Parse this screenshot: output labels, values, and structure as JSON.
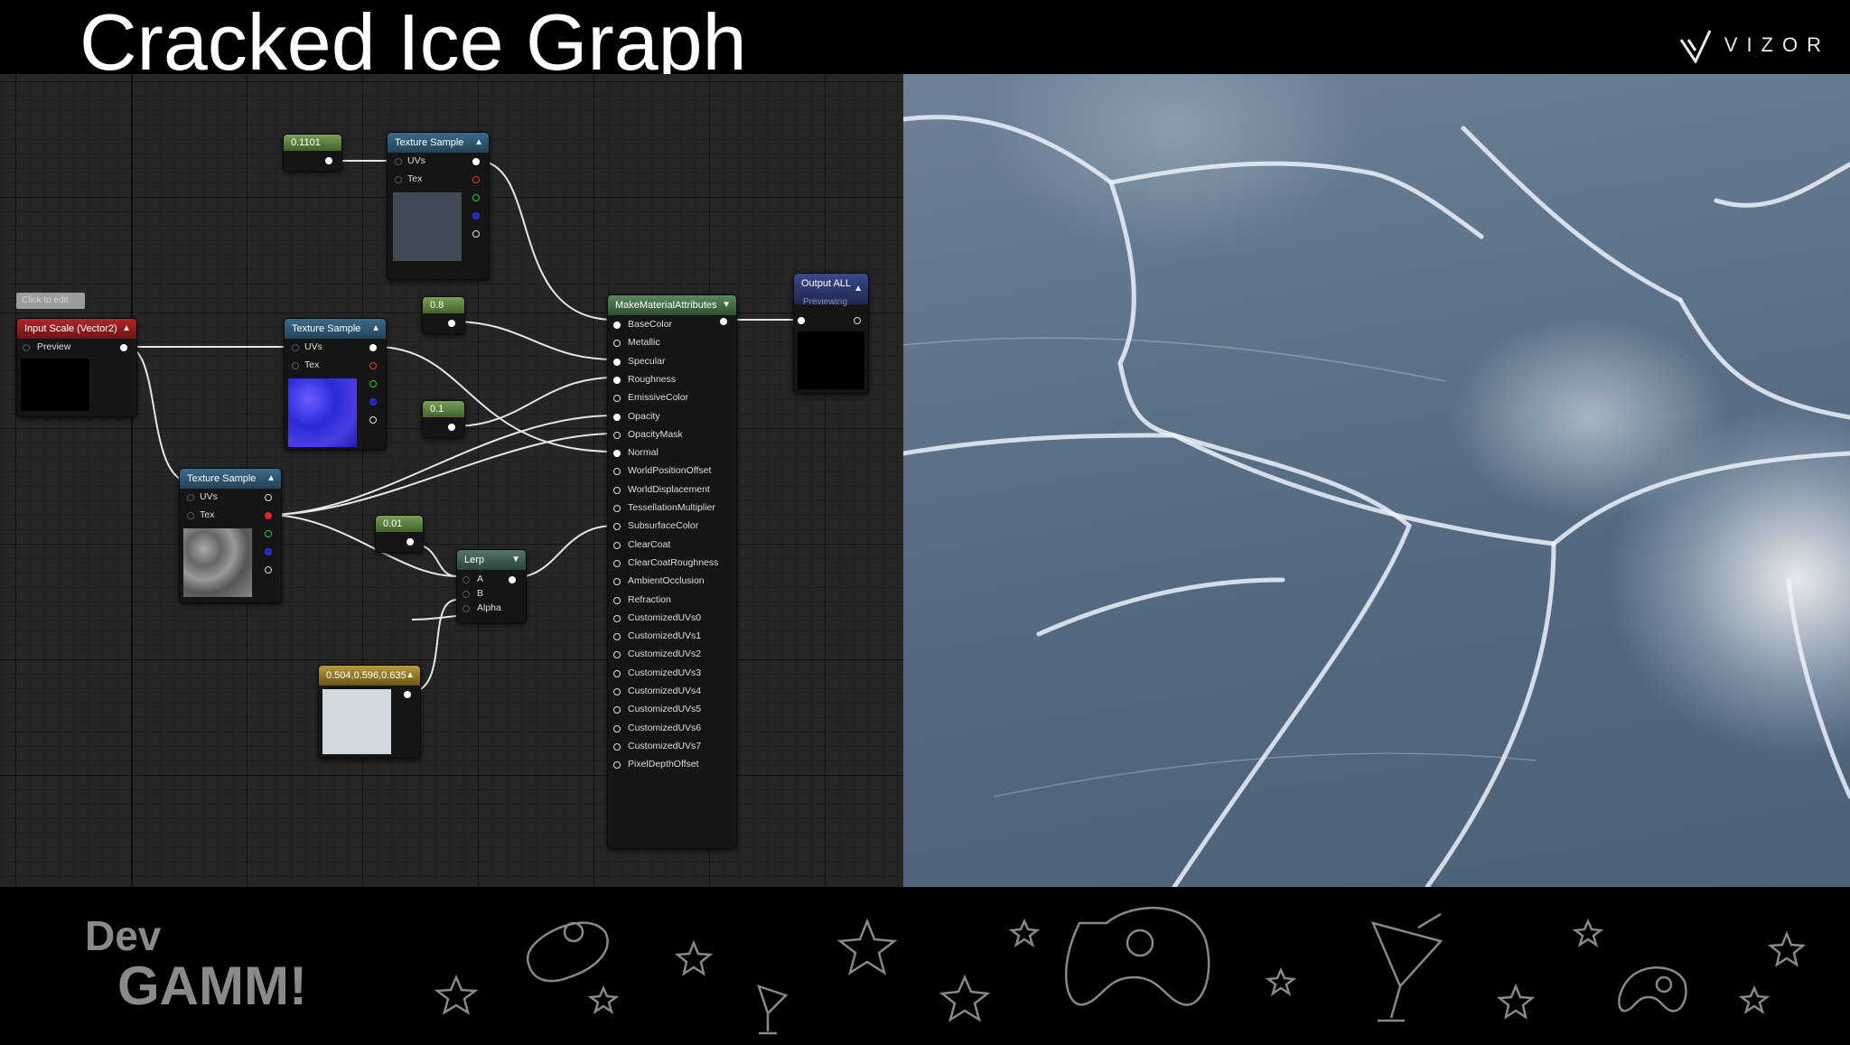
{
  "slide": {
    "title": "Cracked Ice Graph",
    "brand": "VIZOR",
    "footer_logo_line1": "Dev",
    "footer_logo_line2": "GAMM!"
  },
  "graph": {
    "click_to_edit": "Click to edit",
    "nodes": {
      "const_01101": {
        "value": "0.1101"
      },
      "tex_sample_top": {
        "title": "Texture Sample",
        "pins": [
          "UVs",
          "Tex"
        ]
      },
      "input_scale": {
        "title": "Input Scale (Vector2)",
        "pins": [
          "Preview"
        ]
      },
      "tex_sample_mid": {
        "title": "Texture Sample",
        "pins": [
          "UVs",
          "Tex"
        ]
      },
      "const_08": {
        "value": "0.8"
      },
      "const_01": {
        "value": "0.1"
      },
      "tex_sample_low": {
        "title": "Texture Sample",
        "pins": [
          "UVs",
          "Tex"
        ]
      },
      "const_001": {
        "value": "0.01"
      },
      "lerp": {
        "title": "Lerp",
        "pins": [
          "A",
          "B",
          "Alpha"
        ]
      },
      "color_const": {
        "value": "0.504,0.596,0.635"
      },
      "make_material": {
        "title": "MakeMaterialAttributes",
        "pins": [
          "BaseColor",
          "Metallic",
          "Specular",
          "Roughness",
          "EmissiveColor",
          "Opacity",
          "OpacityMask",
          "Normal",
          "WorldPositionOffset",
          "WorldDisplacement",
          "TessellationMultiplier",
          "SubsurfaceColor",
          "ClearCoat",
          "ClearCoatRoughness",
          "AmbientOcclusion",
          "Refraction",
          "CustomizedUVs0",
          "CustomizedUVs1",
          "CustomizedUVs2",
          "CustomizedUVs3",
          "CustomizedUVs4",
          "CustomizedUVs5",
          "CustomizedUVs6",
          "CustomizedUVs7",
          "PixelDepthOffset"
        ]
      },
      "output_all": {
        "title": "Output ALL",
        "status": "Previewing"
      }
    }
  },
  "colors": {
    "node_blue": "#3c6a8a",
    "node_red": "#b3262a",
    "node_green": "#7aa05a",
    "node_gold": "#b89b3a",
    "node_navy": "#3a4a8a",
    "ice": "#5e7388"
  },
  "icons": [
    "vizor-logo-icon",
    "gamepad-icon",
    "star-icon",
    "cocktail-icon"
  ]
}
